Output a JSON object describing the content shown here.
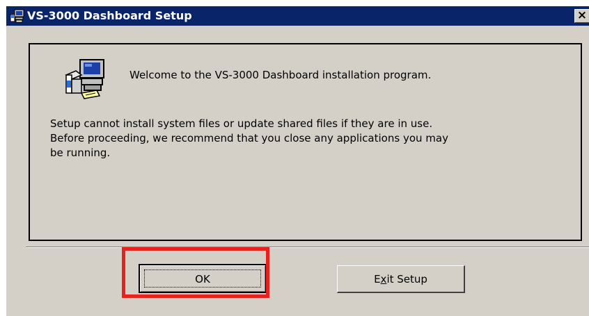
{
  "window": {
    "title": "VS-3000 Dashboard Setup",
    "close_label": "×",
    "app_icon": "setup-computer-icon"
  },
  "panel": {
    "icon": "setup-computer-icon",
    "welcome": "Welcome to the VS-3000 Dashboard installation program.",
    "body_lines": [
      "Setup cannot install system files or update shared files if they are in use.",
      "Before proceeding, we recommend that you close any applications you may",
      "be running."
    ]
  },
  "buttons": {
    "ok_label": "OK",
    "exit_prefix": "E",
    "exit_mnemonic": "x",
    "exit_suffix": "it Setup"
  },
  "colors": {
    "titlebar": "#0a246a",
    "window_bg": "#d4d0c8",
    "highlight": "#e8211e"
  }
}
